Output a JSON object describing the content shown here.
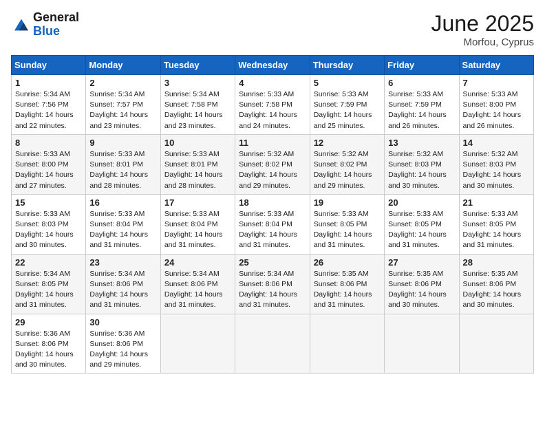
{
  "logo": {
    "general": "General",
    "blue": "Blue"
  },
  "title": "June 2025",
  "location": "Morfou, Cyprus",
  "weekdays": [
    "Sunday",
    "Monday",
    "Tuesday",
    "Wednesday",
    "Thursday",
    "Friday",
    "Saturday"
  ],
  "weeks": [
    [
      {
        "day": "1",
        "sunrise": "Sunrise: 5:34 AM",
        "sunset": "Sunset: 7:56 PM",
        "daylight": "Daylight: 14 hours and 22 minutes."
      },
      {
        "day": "2",
        "sunrise": "Sunrise: 5:34 AM",
        "sunset": "Sunset: 7:57 PM",
        "daylight": "Daylight: 14 hours and 23 minutes."
      },
      {
        "day": "3",
        "sunrise": "Sunrise: 5:34 AM",
        "sunset": "Sunset: 7:58 PM",
        "daylight": "Daylight: 14 hours and 23 minutes."
      },
      {
        "day": "4",
        "sunrise": "Sunrise: 5:33 AM",
        "sunset": "Sunset: 7:58 PM",
        "daylight": "Daylight: 14 hours and 24 minutes."
      },
      {
        "day": "5",
        "sunrise": "Sunrise: 5:33 AM",
        "sunset": "Sunset: 7:59 PM",
        "daylight": "Daylight: 14 hours and 25 minutes."
      },
      {
        "day": "6",
        "sunrise": "Sunrise: 5:33 AM",
        "sunset": "Sunset: 7:59 PM",
        "daylight": "Daylight: 14 hours and 26 minutes."
      },
      {
        "day": "7",
        "sunrise": "Sunrise: 5:33 AM",
        "sunset": "Sunset: 8:00 PM",
        "daylight": "Daylight: 14 hours and 26 minutes."
      }
    ],
    [
      {
        "day": "8",
        "sunrise": "Sunrise: 5:33 AM",
        "sunset": "Sunset: 8:00 PM",
        "daylight": "Daylight: 14 hours and 27 minutes."
      },
      {
        "day": "9",
        "sunrise": "Sunrise: 5:33 AM",
        "sunset": "Sunset: 8:01 PM",
        "daylight": "Daylight: 14 hours and 28 minutes."
      },
      {
        "day": "10",
        "sunrise": "Sunrise: 5:33 AM",
        "sunset": "Sunset: 8:01 PM",
        "daylight": "Daylight: 14 hours and 28 minutes."
      },
      {
        "day": "11",
        "sunrise": "Sunrise: 5:32 AM",
        "sunset": "Sunset: 8:02 PM",
        "daylight": "Daylight: 14 hours and 29 minutes."
      },
      {
        "day": "12",
        "sunrise": "Sunrise: 5:32 AM",
        "sunset": "Sunset: 8:02 PM",
        "daylight": "Daylight: 14 hours and 29 minutes."
      },
      {
        "day": "13",
        "sunrise": "Sunrise: 5:32 AM",
        "sunset": "Sunset: 8:03 PM",
        "daylight": "Daylight: 14 hours and 30 minutes."
      },
      {
        "day": "14",
        "sunrise": "Sunrise: 5:32 AM",
        "sunset": "Sunset: 8:03 PM",
        "daylight": "Daylight: 14 hours and 30 minutes."
      }
    ],
    [
      {
        "day": "15",
        "sunrise": "Sunrise: 5:33 AM",
        "sunset": "Sunset: 8:03 PM",
        "daylight": "Daylight: 14 hours and 30 minutes."
      },
      {
        "day": "16",
        "sunrise": "Sunrise: 5:33 AM",
        "sunset": "Sunset: 8:04 PM",
        "daylight": "Daylight: 14 hours and 31 minutes."
      },
      {
        "day": "17",
        "sunrise": "Sunrise: 5:33 AM",
        "sunset": "Sunset: 8:04 PM",
        "daylight": "Daylight: 14 hours and 31 minutes."
      },
      {
        "day": "18",
        "sunrise": "Sunrise: 5:33 AM",
        "sunset": "Sunset: 8:04 PM",
        "daylight": "Daylight: 14 hours and 31 minutes."
      },
      {
        "day": "19",
        "sunrise": "Sunrise: 5:33 AM",
        "sunset": "Sunset: 8:05 PM",
        "daylight": "Daylight: 14 hours and 31 minutes."
      },
      {
        "day": "20",
        "sunrise": "Sunrise: 5:33 AM",
        "sunset": "Sunset: 8:05 PM",
        "daylight": "Daylight: 14 hours and 31 minutes."
      },
      {
        "day": "21",
        "sunrise": "Sunrise: 5:33 AM",
        "sunset": "Sunset: 8:05 PM",
        "daylight": "Daylight: 14 hours and 31 minutes."
      }
    ],
    [
      {
        "day": "22",
        "sunrise": "Sunrise: 5:34 AM",
        "sunset": "Sunset: 8:05 PM",
        "daylight": "Daylight: 14 hours and 31 minutes."
      },
      {
        "day": "23",
        "sunrise": "Sunrise: 5:34 AM",
        "sunset": "Sunset: 8:06 PM",
        "daylight": "Daylight: 14 hours and 31 minutes."
      },
      {
        "day": "24",
        "sunrise": "Sunrise: 5:34 AM",
        "sunset": "Sunset: 8:06 PM",
        "daylight": "Daylight: 14 hours and 31 minutes."
      },
      {
        "day": "25",
        "sunrise": "Sunrise: 5:34 AM",
        "sunset": "Sunset: 8:06 PM",
        "daylight": "Daylight: 14 hours and 31 minutes."
      },
      {
        "day": "26",
        "sunrise": "Sunrise: 5:35 AM",
        "sunset": "Sunset: 8:06 PM",
        "daylight": "Daylight: 14 hours and 31 minutes."
      },
      {
        "day": "27",
        "sunrise": "Sunrise: 5:35 AM",
        "sunset": "Sunset: 8:06 PM",
        "daylight": "Daylight: 14 hours and 30 minutes."
      },
      {
        "day": "28",
        "sunrise": "Sunrise: 5:35 AM",
        "sunset": "Sunset: 8:06 PM",
        "daylight": "Daylight: 14 hours and 30 minutes."
      }
    ],
    [
      {
        "day": "29",
        "sunrise": "Sunrise: 5:36 AM",
        "sunset": "Sunset: 8:06 PM",
        "daylight": "Daylight: 14 hours and 30 minutes."
      },
      {
        "day": "30",
        "sunrise": "Sunrise: 5:36 AM",
        "sunset": "Sunset: 8:06 PM",
        "daylight": "Daylight: 14 hours and 29 minutes."
      },
      null,
      null,
      null,
      null,
      null
    ]
  ]
}
